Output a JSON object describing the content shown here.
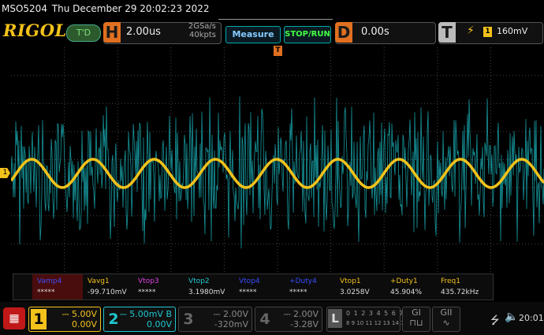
{
  "title_bar": {
    "model": "MSO5204",
    "datetime": "Thu December 29 20:02:23 2022"
  },
  "brand": {
    "logo": "RIGOL",
    "mode_badge": "T'D"
  },
  "horizontal": {
    "letter": "H",
    "timebase": "2.00us",
    "sample_rate": "2GSa/s",
    "memory_depth": "40kpts"
  },
  "buttons": {
    "measure": "Measure",
    "stop_run": "STOP/RUN"
  },
  "delay": {
    "letter": "D",
    "value": "0.00s"
  },
  "trigger": {
    "letter": "T",
    "source": "1",
    "level": "160mV",
    "marker": "T"
  },
  "measurements": [
    {
      "name": "Vamp4",
      "value": "*****",
      "color": "#3b4cff"
    },
    {
      "name": "Vavg1",
      "value": "-99.710mV",
      "color": "#f3c21b"
    },
    {
      "name": "Vtop3",
      "value": "*****",
      "color": "#e040e0"
    },
    {
      "name": "Vtop2",
      "value": "3.1980mV",
      "color": "#1ec8d0"
    },
    {
      "name": "Vtop4",
      "value": "*****",
      "color": "#3b4cff"
    },
    {
      "name": "+Duty4",
      "value": "*****",
      "color": "#3b4cff"
    },
    {
      "name": "Vtop1",
      "value": "3.0258V",
      "color": "#f3c21b"
    },
    {
      "name": "+Duty1",
      "value": "45.904%",
      "color": "#f3c21b"
    },
    {
      "name": "Freq1",
      "value": "435.72kHz",
      "color": "#f3c21b"
    }
  ],
  "channels": [
    {
      "num": "1",
      "scale": "5.00V",
      "offset": "0.00V",
      "marker": "1"
    },
    {
      "num": "2",
      "scale": "5.00mV",
      "bw": "B",
      "offset": "0.00V"
    },
    {
      "num": "3",
      "scale": "2.00V",
      "offset": "-320mV"
    },
    {
      "num": "4",
      "scale": "2.00V",
      "offset": "-3.28V"
    }
  ],
  "logic": {
    "letter": "L",
    "row1": "0 1 2 3 4 5 6 7",
    "row2": "8 9 10 11 12 13 14 15"
  },
  "generators": [
    {
      "label": "GI"
    },
    {
      "label": "GII"
    }
  ],
  "status": {
    "time": "20:01",
    "usb_icon": "usb-icon",
    "volume_icon": "speaker-icon",
    "menu_icon": "grid-menu-icon"
  },
  "colors": {
    "ch1": "#f3c21b",
    "ch2": "#1ec8d0",
    "accent": "#e07020"
  },
  "waveforms": {
    "ch1_frequency_kHz": 435.72,
    "ch1_cycles_on_screen": 8.7,
    "ch2_noise": true
  }
}
